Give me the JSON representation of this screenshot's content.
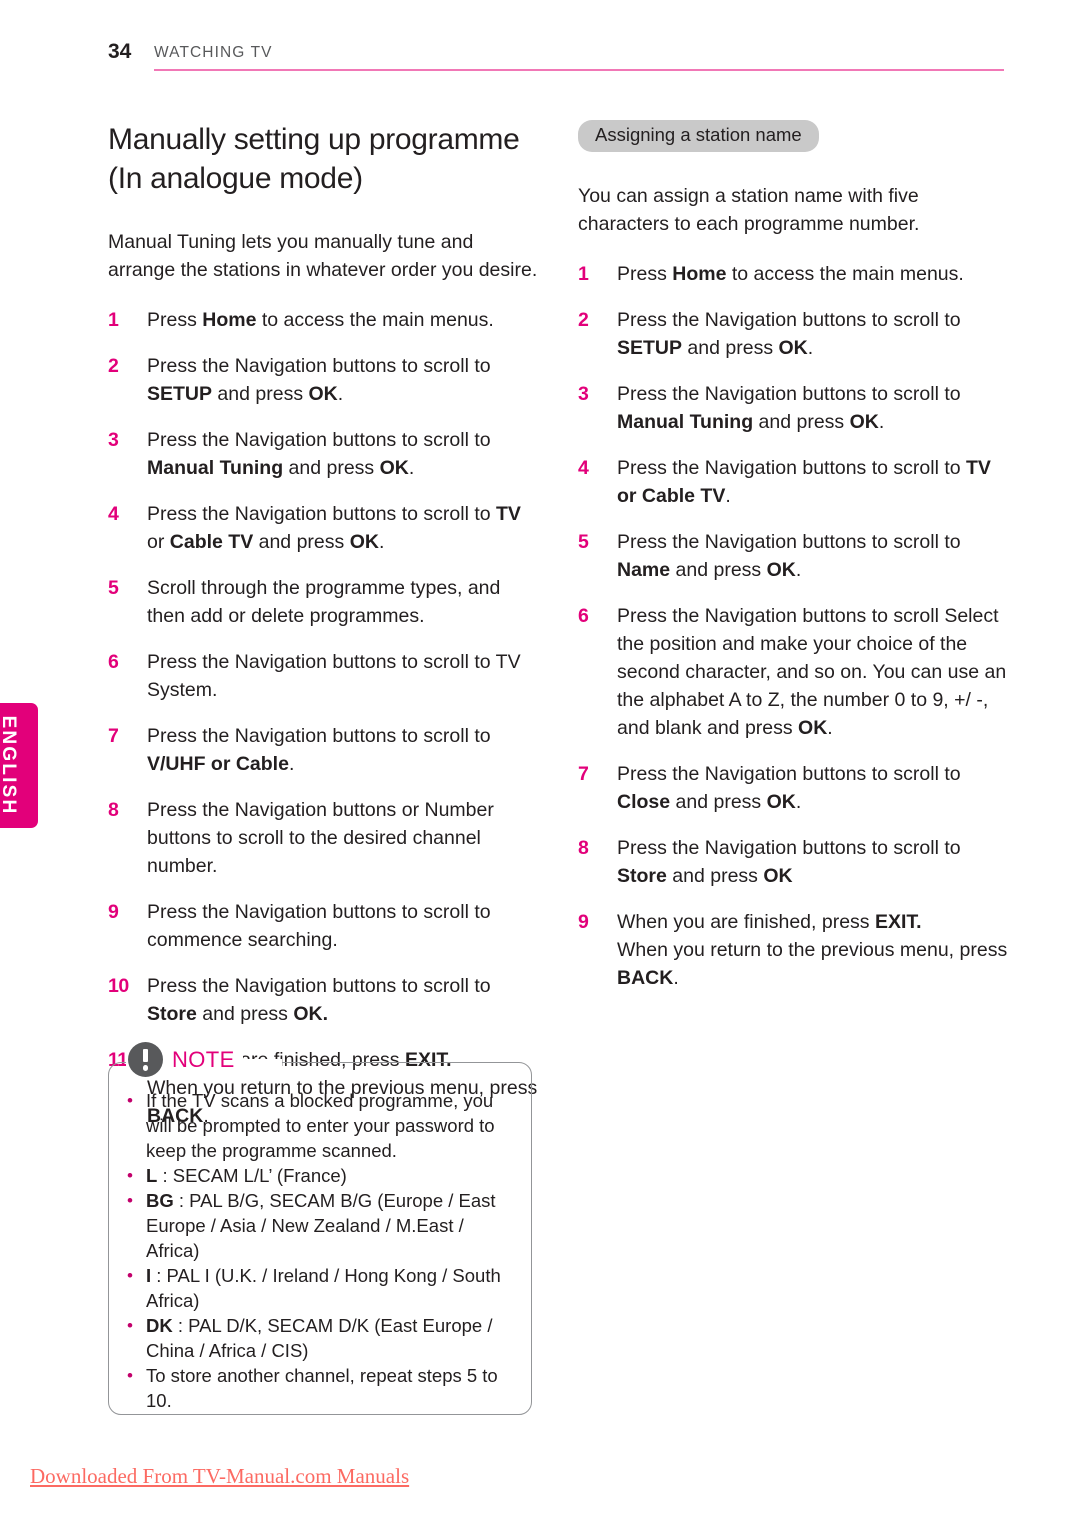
{
  "header": {
    "page_number": "34",
    "title": "WATCHING TV",
    "rule_color": "#f178b6"
  },
  "side_tab": {
    "label": "ENGLISH",
    "color": "#e2007a"
  },
  "left_column": {
    "section_title": "Manually setting up programme (In analogue mode)",
    "intro": "Manual Tuning lets you manually tune and arrange the stations in whatever order you desire.",
    "steps": [
      {
        "num": "1",
        "html": "Press <b>Home</b> to access the main menus."
      },
      {
        "num": "2",
        "html": "Press the Navigation buttons to scroll to <b>SETUP</b> and press <b>OK</b>."
      },
      {
        "num": "3",
        "html": "Press the Navigation buttons to scroll to <b>Manual Tuning</b> and press <b>OK</b>."
      },
      {
        "num": "4",
        "html": "Press the Navigation buttons to scroll to <b>TV</b> or <b>Cable TV</b> and press <b>OK</b>."
      },
      {
        "num": "5",
        "html": "Scroll through the programme types, and then add or delete programmes."
      },
      {
        "num": "6",
        "html": "Press the Navigation buttons to scroll to TV System."
      },
      {
        "num": "7",
        "html": "Press the Navigation buttons to scroll to <b>V/UHF or Cable</b>."
      },
      {
        "num": "8",
        "html": "Press the Navigation buttons or Number buttons to scroll to the desired channel number."
      },
      {
        "num": "9",
        "html": "Press the Navigation buttons to scroll to commence searching."
      },
      {
        "num": "10",
        "html": "Press the Navigation buttons to scroll to <b>Store</b> and press <b>OK.</b>"
      },
      {
        "num": "11",
        "html": "When you are finished, press <b>EXIT.</b><br>When you return to the previous menu, press <b>BACK</b>."
      }
    ]
  },
  "right_column": {
    "pill_heading": "Assigning a station name",
    "intro": "You can assign a station name with five characters to each programme number.",
    "steps": [
      {
        "num": "1",
        "html": "Press <b>Home</b> to access the main menus."
      },
      {
        "num": "2",
        "html": "Press the Navigation buttons to scroll to <b>SETUP</b> and press <b>OK</b>."
      },
      {
        "num": "3",
        "html": "Press the Navigation buttons to scroll to <b>Manual Tuning</b> and press <b>OK</b>."
      },
      {
        "num": "4",
        "html": "Press the Navigation buttons to scroll to <b>TV or Cable TV</b>."
      },
      {
        "num": "5",
        "html": "Press the Navigation buttons to scroll to <b>Name</b> and press <b>OK</b>."
      },
      {
        "num": "6",
        "html": "Press the Navigation buttons to scroll Select the position and make your choice of the second character, and so on. You can use an the alphabet A to Z, the number 0 to 9, +/ -, and blank and press <b>OK</b>."
      },
      {
        "num": "7",
        "html": "Press the Navigation buttons to scroll to <b>Close</b> and press <b>OK</b>."
      },
      {
        "num": "8",
        "html": "Press the Navigation buttons to scroll to <b>Store</b> and press <b>OK</b>"
      },
      {
        "num": "9",
        "html": "When you are finished, press <b>EXIT.</b><br>When you return to the previous menu, press <b>BACK</b>."
      }
    ]
  },
  "note": {
    "title": "NOTE",
    "icon": "exclamation-circle-icon",
    "items": [
      {
        "html": "If the TV scans a blocked programme, you will be prompted to enter your password to keep the programme scanned."
      },
      {
        "html": "<b>L</b> : SECAM L/L’ (France)"
      },
      {
        "html": "<b>BG</b> : PAL B/G, SECAM B/G (Europe / East Europe / Asia / New Zealand / M.East / Africa)"
      },
      {
        "html": "<b>I</b> : PAL I (U.K. / Ireland / Hong Kong / South Africa)"
      },
      {
        "html": "<b>DK</b> : PAL D/K, SECAM D/K (East Europe / China / Africa / CIS)"
      },
      {
        "html": "To store another channel, repeat steps 5 to 10."
      }
    ]
  },
  "footer": {
    "link_text": "Downloaded From TV-Manual.com Manuals",
    "color": "#fc6a62"
  }
}
